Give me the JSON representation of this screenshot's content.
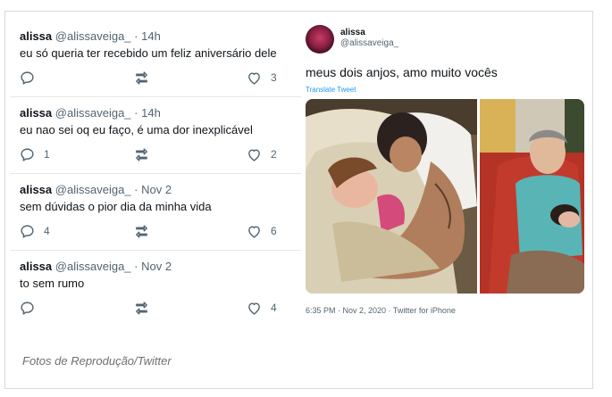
{
  "left_tweets": [
    {
      "name": "alissa",
      "handle": "@alissaveiga_",
      "dot": "·",
      "time": "14h",
      "text": "eu só queria ter recebido um feliz aniversário dele",
      "likes": "3",
      "replies": ""
    },
    {
      "name": "alissa",
      "handle": "@alissaveiga_",
      "dot": "·",
      "time": "14h",
      "text": "eu nao sei oq eu faço, é uma dor inexplicável",
      "likes": "2",
      "replies": "1"
    },
    {
      "name": "alissa",
      "handle": "@alissaveiga_",
      "dot": "·",
      "time": "Nov 2",
      "text": "sem dúvidas o pior dia da minha vida",
      "likes": "6",
      "replies": "4"
    },
    {
      "name": "alissa",
      "handle": "@alissaveiga_",
      "dot": "·",
      "time": "Nov 2",
      "text": "to sem rumo",
      "likes": "4",
      "replies": ""
    }
  ],
  "right_tweet": {
    "name": "alissa",
    "handle": "@alissaveiga_",
    "text": "meus dois anjos, amo muito vocês",
    "translate": "Translate Tweet",
    "meta": "6:35 PM · Nov 2, 2020 · Twitter for iPhone"
  },
  "caption": "Fotos de Reprodução/Twitter",
  "icons": [
    "reply-icon",
    "retweet-icon",
    "heart-icon"
  ],
  "colors": {
    "text": "#0f1419",
    "muted": "#536471",
    "link": "#1d9bf0",
    "border": "#e6e6e6"
  }
}
